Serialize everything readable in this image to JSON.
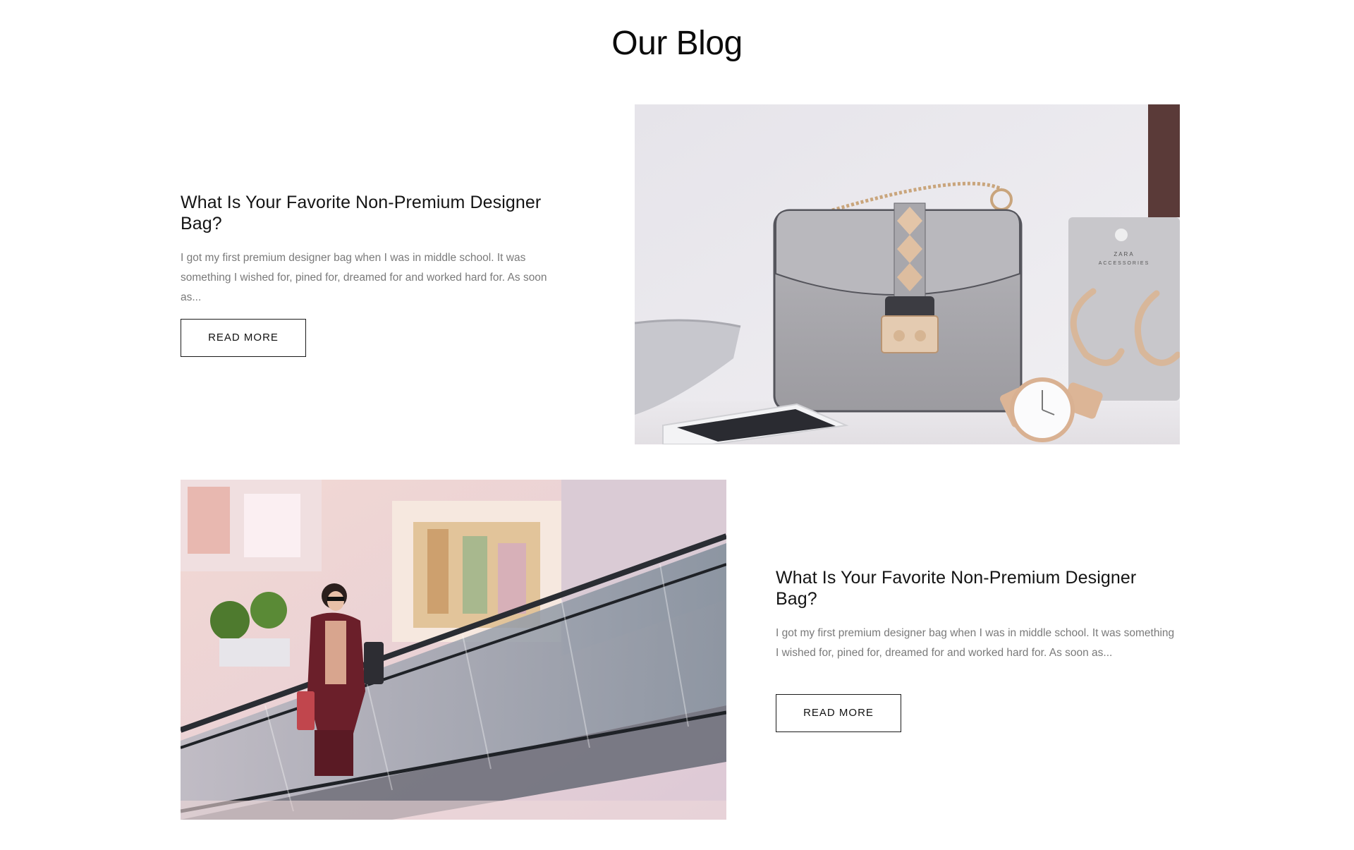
{
  "section": {
    "title": "Our Blog"
  },
  "posts": [
    {
      "heading": "What Is Your Favorite Non-Premium Designer Bag?",
      "excerpt": "I got my first premium designer bag when I was in middle school. It was something I wished for, pined for, dreamed for and worked hard for. As soon as...",
      "button_label": "READ MORE",
      "image_subject": "grey-handbag-with-watch-and-earrings",
      "image_text": [
        "ZARA",
        "ACCESSORIES"
      ]
    },
    {
      "heading": "What Is Your Favorite Non-Premium Designer Bag?",
      "excerpt": "I got my first premium designer bag when I was in middle school. It was something I wished for, pined for, dreamed for and worked hard for. As soon as...",
      "button_label": "READ MORE",
      "image_subject": "woman-shopping-on-escalator"
    }
  ],
  "colors": {
    "heading": "#141414",
    "excerpt": "#7a7a7a",
    "button_border": "#1a1a1a",
    "background": "#ffffff"
  }
}
